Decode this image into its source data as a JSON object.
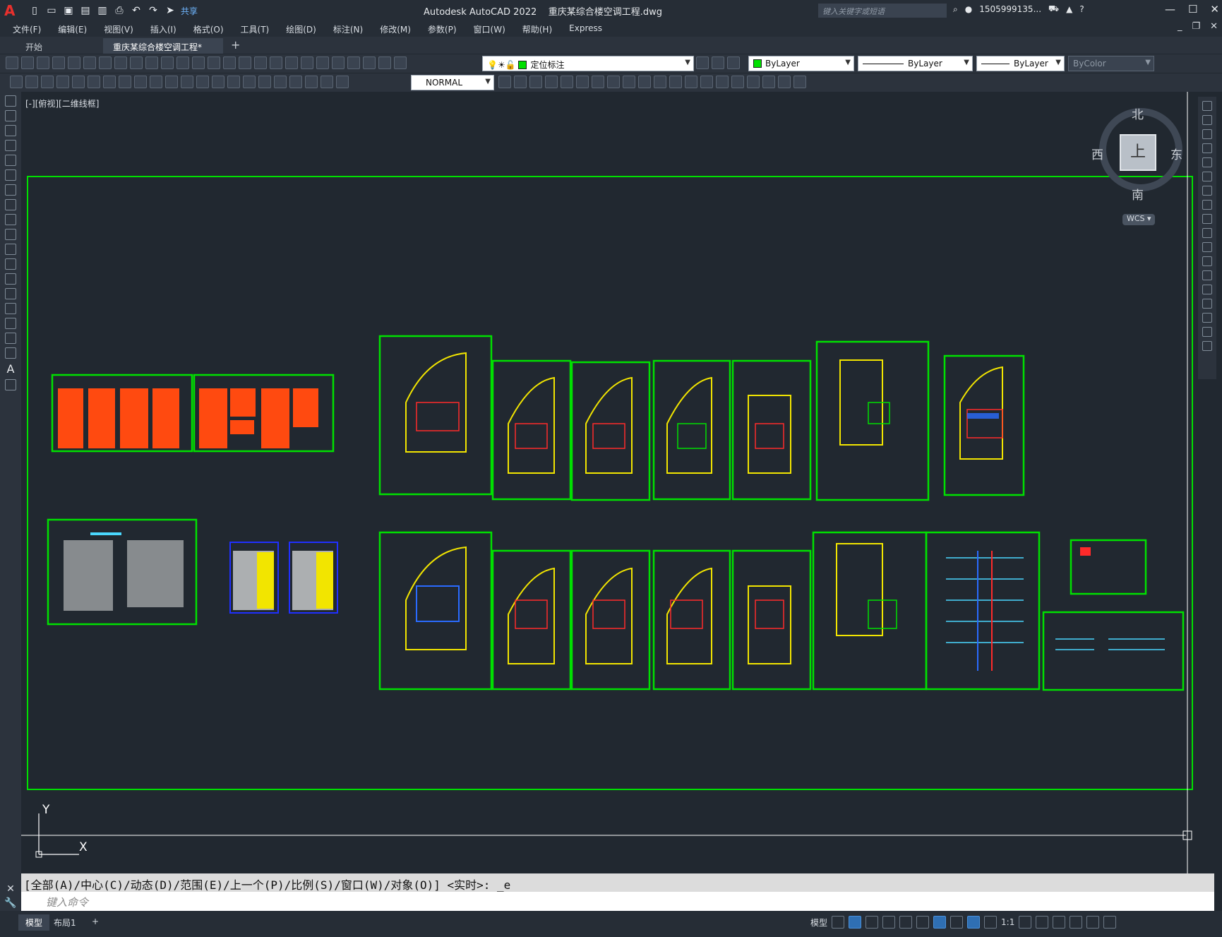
{
  "titlebar": {
    "app_title": "Autodesk AutoCAD 2022",
    "document": "重庆某综合楼空调工程.dwg",
    "share_label": "共享",
    "search_placeholder": "键入关键字或短语",
    "user": "1505999135...",
    "logo": "A"
  },
  "menu": [
    "文件(F)",
    "编辑(E)",
    "视图(V)",
    "插入(I)",
    "格式(O)",
    "工具(T)",
    "绘图(D)",
    "标注(N)",
    "修改(M)",
    "参数(P)",
    "窗口(W)",
    "帮助(H)",
    "Express"
  ],
  "tabs": {
    "start": "开始",
    "drawing": "重庆某综合楼空调工程*",
    "add": "+"
  },
  "properties": {
    "layer": "定位标注",
    "color": "ByLayer",
    "linetype": "ByLayer",
    "lineweight": "ByLayer",
    "plotstyle": "ByColor",
    "textstyle": "NORMAL"
  },
  "viewport": {
    "label": "[-][俯视][二维线框]",
    "compass": {
      "north": "北",
      "south": "南",
      "east": "东",
      "west": "西",
      "cube_face": "上"
    },
    "ucs": "WCS",
    "axis_x": "X",
    "axis_y": "Y"
  },
  "command": {
    "history": "[全部(A)/中心(C)/动态(D)/范围(E)/上一个(P)/比例(S)/窗口(W)/对象(O)] <实时>: _e",
    "placeholder": "键入命令"
  },
  "status": {
    "model_tab": "模型",
    "layout_tab": "布局1",
    "add": "+",
    "model_button": "模型",
    "scale": "1:1"
  },
  "colors": {
    "background": "#212830",
    "frame_green": "#00e000",
    "table_red": "#ff4a10",
    "table_yellow": "#f2e500",
    "table_blue": "#2030ff",
    "command_bar": "#dcdcdc"
  },
  "icons": [
    "new-icon",
    "open-icon",
    "save-icon",
    "undo-icon",
    "redo-icon",
    "share-icon",
    "search-icon",
    "user-icon",
    "cart-icon",
    "help-icon",
    "close-icon",
    "layer-icon",
    "gear-icon"
  ]
}
